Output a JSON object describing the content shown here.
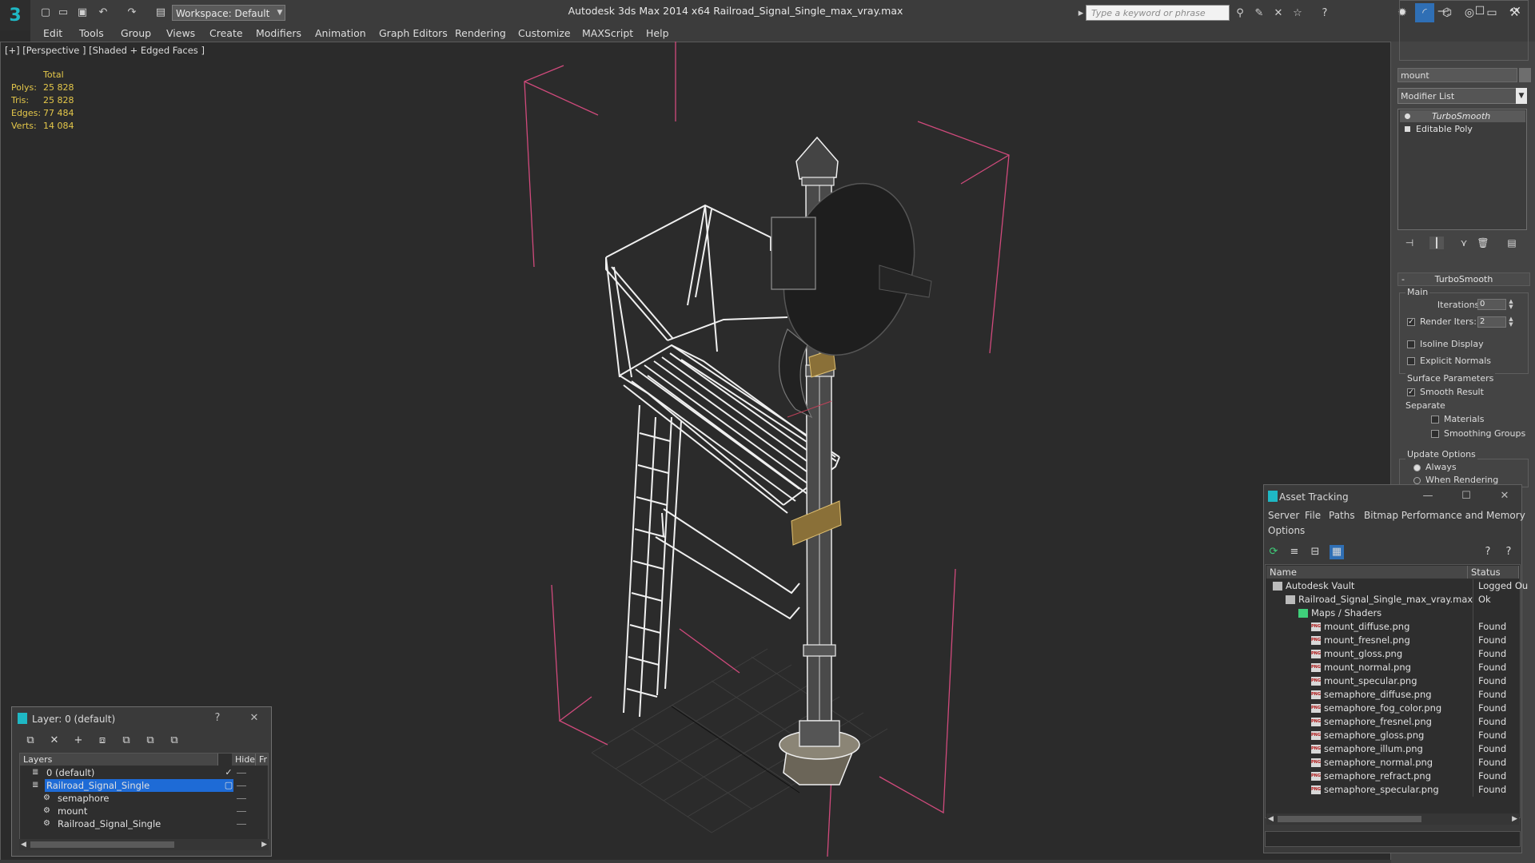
{
  "window": {
    "title": "Autodesk 3ds Max  2014 x64      Railroad_Signal_Single_max_vray.max",
    "workspace": "Workspace: Default",
    "search_placeholder": "Type a keyword or phrase"
  },
  "menu": [
    "Edit",
    "Tools",
    "Group",
    "Views",
    "Create",
    "Modifiers",
    "Animation",
    "Graph Editors",
    "Rendering",
    "Customize",
    "MAXScript",
    "Help"
  ],
  "viewport": {
    "label": "[+] [Perspective ] [Shaded + Edged Faces ]",
    "stats": {
      "header": "Total",
      "rows": [
        {
          "label": "Polys:",
          "value": "25 828"
        },
        {
          "label": "Tris:",
          "value": "25 828"
        },
        {
          "label": "Edges:",
          "value": "77 484"
        },
        {
          "label": "Verts:",
          "value": "14 084"
        }
      ]
    }
  },
  "command_panel": {
    "object_name": "mount",
    "modifier_list": "Modifier List",
    "stack": [
      "TurboSmooth",
      "Editable Poly"
    ],
    "rollout_title": "TurboSmooth",
    "main_group": "Main",
    "iterations_label": "Iterations:",
    "iterations_value": "0",
    "render_iters_label": "Render Iters:",
    "render_iters_value": "2",
    "isoline_display": "Isoline Display",
    "explicit_normals": "Explicit Normals",
    "surface_parameters": "Surface Parameters",
    "smooth_result": "Smooth Result",
    "separate": "Separate",
    "materials": "Materials",
    "smoothing_groups": "Smoothing Groups",
    "update_options": "Update Options",
    "always": "Always",
    "when_rendering": "When Rendering"
  },
  "asset_tracking": {
    "title": "Asset Tracking",
    "menu": [
      "Server",
      "File",
      "Paths",
      "Bitmap Performance and Memory",
      "Options"
    ],
    "columns": [
      "Name",
      "Status"
    ],
    "rows": [
      {
        "name": "Autodesk Vault",
        "status": "Logged Ou",
        "level": 0,
        "kind": "vault"
      },
      {
        "name": "Railroad_Signal_Single_max_vray.max",
        "status": "Ok",
        "level": 1,
        "kind": "file"
      },
      {
        "name": "Maps / Shaders",
        "status": "",
        "level": 2,
        "kind": "folder"
      },
      {
        "name": "mount_diffuse.png",
        "status": "Found",
        "level": 3,
        "kind": "png"
      },
      {
        "name": "mount_fresnel.png",
        "status": "Found",
        "level": 3,
        "kind": "png"
      },
      {
        "name": "mount_gloss.png",
        "status": "Found",
        "level": 3,
        "kind": "png"
      },
      {
        "name": "mount_normal.png",
        "status": "Found",
        "level": 3,
        "kind": "png"
      },
      {
        "name": "mount_specular.png",
        "status": "Found",
        "level": 3,
        "kind": "png"
      },
      {
        "name": "semaphore_diffuse.png",
        "status": "Found",
        "level": 3,
        "kind": "png"
      },
      {
        "name": "semaphore_fog_color.png",
        "status": "Found",
        "level": 3,
        "kind": "png"
      },
      {
        "name": "semaphore_fresnel.png",
        "status": "Found",
        "level": 3,
        "kind": "png"
      },
      {
        "name": "semaphore_gloss.png",
        "status": "Found",
        "level": 3,
        "kind": "png"
      },
      {
        "name": "semaphore_illum.png",
        "status": "Found",
        "level": 3,
        "kind": "png"
      },
      {
        "name": "semaphore_normal.png",
        "status": "Found",
        "level": 3,
        "kind": "png"
      },
      {
        "name": "semaphore_refract.png",
        "status": "Found",
        "level": 3,
        "kind": "png"
      },
      {
        "name": "semaphore_specular.png",
        "status": "Found",
        "level": 3,
        "kind": "png"
      }
    ]
  },
  "layer_explorer": {
    "title": "Layer: 0 (default)",
    "help": "?",
    "columns": [
      "Layers",
      "Hide",
      "Fr"
    ],
    "rows": [
      {
        "name": "0 (default)",
        "level": 0,
        "selected": false,
        "current": true
      },
      {
        "name": "Railroad_Signal_Single",
        "level": 0,
        "selected": true,
        "current": false
      },
      {
        "name": "semaphore",
        "level": 1,
        "selected": false,
        "current": false
      },
      {
        "name": "mount",
        "level": 1,
        "selected": false,
        "current": false
      },
      {
        "name": "Railroad_Signal_Single",
        "level": 1,
        "selected": false,
        "current": false
      }
    ]
  },
  "colors": {
    "selection_blue": "#1e6bd6",
    "stats_yellow": "#e5c84a",
    "bbox_pink": "#d04a7c",
    "app_teal": "#1fb8c4"
  }
}
